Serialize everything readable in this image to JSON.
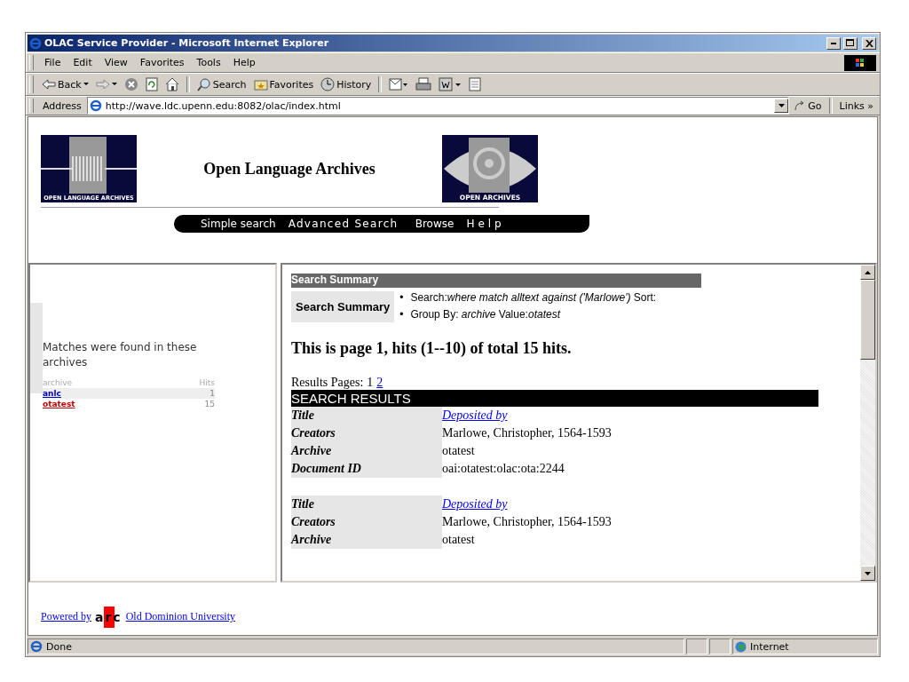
{
  "window": {
    "title": "OLAC Service Provider - Microsoft Internet Explorer"
  },
  "menu": [
    "File",
    "Edit",
    "View",
    "Favorites",
    "Tools",
    "Help"
  ],
  "toolbar": [
    {
      "kind": "back",
      "label": "Back"
    },
    {
      "kind": "forward"
    },
    {
      "kind": "stop"
    },
    {
      "kind": "refresh"
    },
    {
      "kind": "home"
    },
    {
      "kind": "search",
      "label": "Search"
    },
    {
      "kind": "favorites",
      "label": "Favorites"
    },
    {
      "kind": "history",
      "label": "History"
    },
    {
      "kind": "mail"
    },
    {
      "kind": "print"
    },
    {
      "kind": "edit"
    },
    {
      "kind": "discuss"
    }
  ],
  "address": {
    "label": "Address",
    "url": "http://wave.ldc.upenn.edu:8082/olac/index.html",
    "go": "Go",
    "links": "Links »"
  },
  "header": {
    "left_logo_caption": "OPEN LANGUAGE ARCHIVES",
    "title": "Open Language Archives",
    "right_logo_caption": "OPEN ARCHIVES",
    "nav": [
      {
        "label": "Simple search",
        "kind": "plain"
      },
      {
        "label": "Advanced Search",
        "kind": "spaced"
      },
      {
        "label": "Browse",
        "kind": "plain"
      },
      {
        "label": "Help",
        "kind": "wide"
      }
    ]
  },
  "archives": {
    "heading": "Matches were found in these archives",
    "columns": [
      "archive",
      "Hits"
    ],
    "rows": [
      {
        "archive": "anlc",
        "hits": "1",
        "selected": false
      },
      {
        "archive": "otatest",
        "hits": "15",
        "selected": true
      }
    ]
  },
  "summary": {
    "bar": "Search Summary",
    "label": "Search Summary",
    "bullet": "•",
    "items": [
      "Search:*where match alltext against ('Marlowe')* Sort:",
      "Group By: *archive* Value:*otatest*"
    ]
  },
  "page_info": "This is page 1, hits (1--10) of total 15 hits.",
  "results_pages": {
    "label": "Results Pages:",
    "pages": [
      {
        "label": "1",
        "selected": true
      },
      {
        "label": "2",
        "selected": false
      }
    ]
  },
  "results_bar": "SEARCH RESULTS",
  "records": [
    [
      {
        "label": "Title",
        "value": "Deposited by",
        "kind": "link"
      },
      {
        "label": "Creators",
        "value": "Marlowe, Christopher, 1564-1593",
        "kind": "text"
      },
      {
        "label": "Archive",
        "value": "otatest",
        "kind": "text"
      },
      {
        "label": "Document ID",
        "value": "oai:otatest:olac:ota:2244",
        "kind": "text"
      }
    ],
    [
      {
        "label": "Title",
        "value": "Deposited by",
        "kind": "link"
      },
      {
        "label": "Creators",
        "value": "Marlowe, Christopher, 1564-1593",
        "kind": "text"
      },
      {
        "label": "Archive",
        "value": "otatest",
        "kind": "text"
      }
    ]
  ],
  "footer": {
    "powered_by": "Powered by",
    "logo": "arc",
    "university": "Old Dominion University"
  },
  "status_bar": {
    "text": "Done",
    "zone": "Internet"
  }
}
